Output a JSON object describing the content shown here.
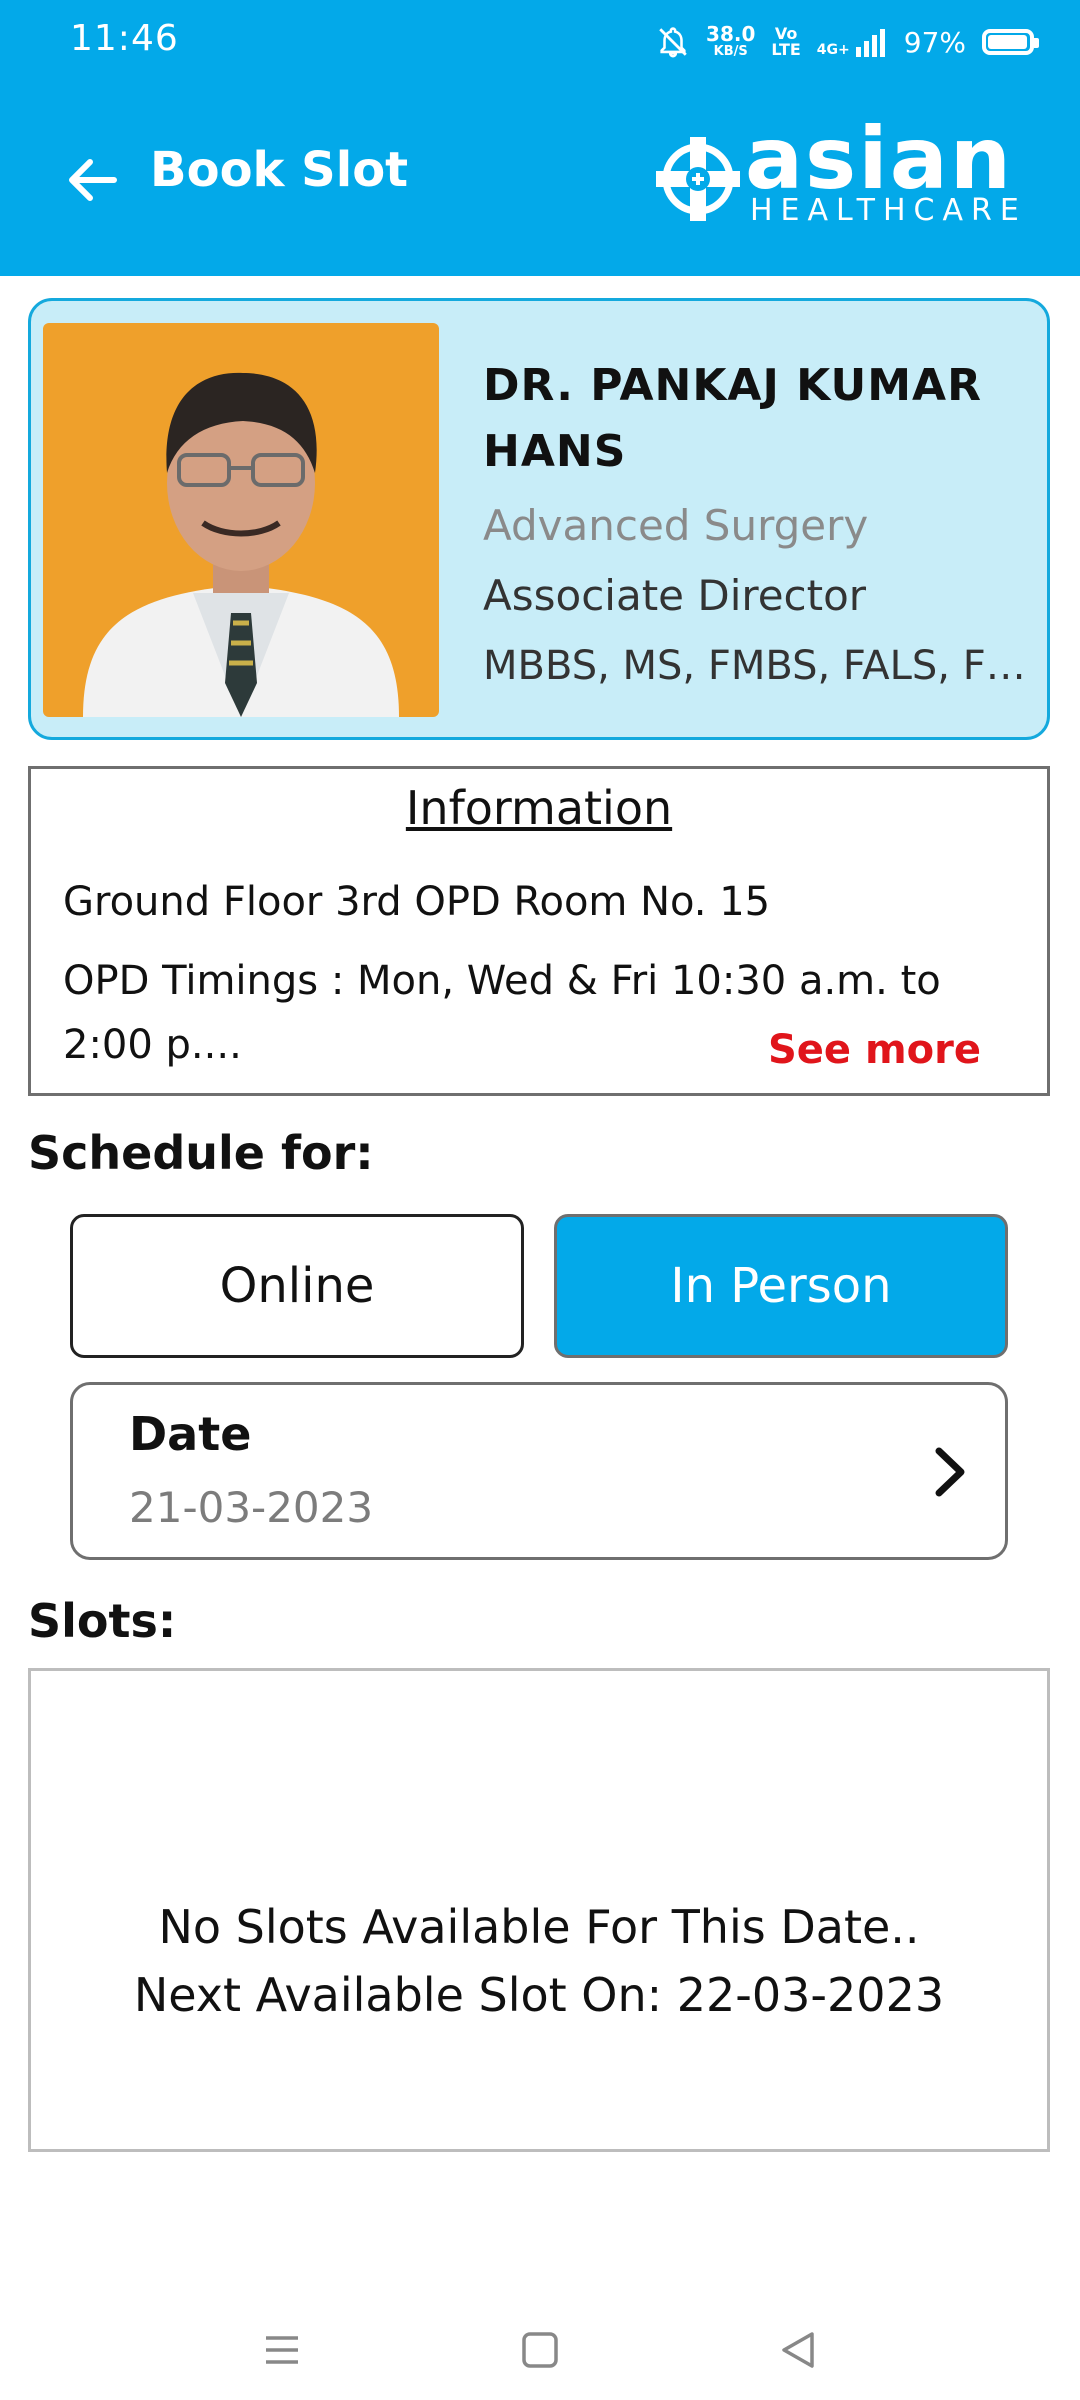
{
  "status_bar": {
    "time": "11:46",
    "speed_value": "38.0",
    "speed_unit": "KB/S",
    "volte_top": "Vo",
    "volte_bottom": "LTE",
    "network": "4G+",
    "battery_percent": "97%",
    "battery_level": 0.97
  },
  "header": {
    "back_icon": "arrow-left-icon",
    "title": "Book Slot",
    "logo_word": "asian",
    "logo_sub": "HEALTHCARE"
  },
  "doctor": {
    "name": "DR. PANKAJ KUMAR HANS",
    "specialty": "Advanced Surgery",
    "role": "Associate Director",
    "qualifications": "MBBS, MS, FMBS, FALS, FE..."
  },
  "information": {
    "heading": "Information",
    "room": "Ground Floor 3rd OPD Room No. 15",
    "timings": "OPD Timings : Mon, Wed & Fri 10:30 a.m. to 2:00 p....",
    "see_more": "See more"
  },
  "schedule": {
    "label": "Schedule for:",
    "online_label": "Online",
    "in_person_label": "In Person",
    "selected": "In Person",
    "date_label": "Date",
    "date_value": "21-03-2023"
  },
  "slots": {
    "label": "Slots:",
    "message_line1": "No Slots Available For This Date..",
    "message_line2": "Next Available Slot On: 22-03-2023"
  },
  "colors": {
    "primary": "#03a9e9",
    "card_bg": "#c8edf8",
    "see_more": "#e0151b"
  },
  "nav_icons": [
    "menu-icon",
    "home-icon",
    "back-triangle-icon"
  ]
}
